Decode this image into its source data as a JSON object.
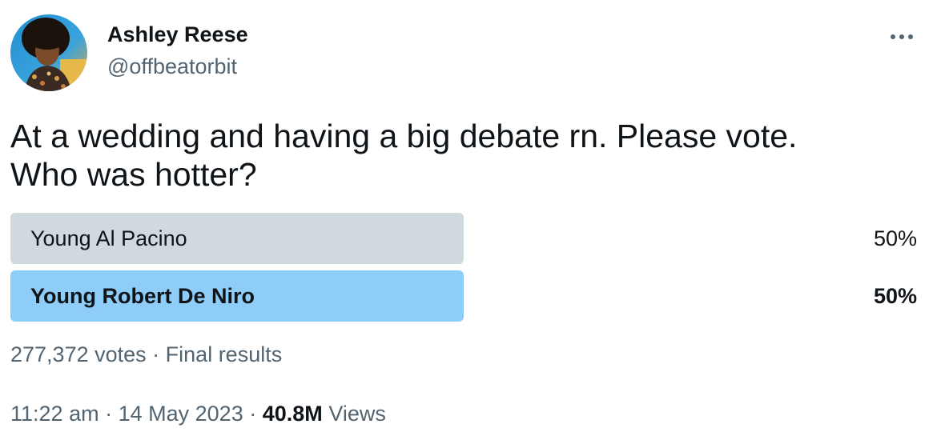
{
  "author": {
    "name": "Ashley Reese",
    "handle": "@offbeatorbit"
  },
  "menu": {
    "icon": "more-horizontal-icon"
  },
  "tweet": {
    "text": "At a wedding and having a big debate rn. Please vote.\nWho was hotter?"
  },
  "poll": {
    "options": [
      {
        "label": "Young Al Pacino",
        "percent_label": "50%",
        "fraction": 0.5,
        "color": "#cfd9de",
        "winner": false
      },
      {
        "label": "Young Robert De Niro",
        "percent_label": "50%",
        "fraction": 0.5,
        "color": "#8ecdf8",
        "winner": true
      }
    ],
    "votes": "277,372 votes",
    "separator": "·",
    "status": "Final results"
  },
  "meta": {
    "time": "11:22 am",
    "separator": "·",
    "date": "14 May 2023",
    "views_count": "40.8M",
    "views_label": "Views"
  },
  "colors": {
    "text": "#0f1419",
    "secondary": "#536471",
    "loser_bar": "#cfd9de",
    "winner_bar": "#8ecdf8"
  }
}
